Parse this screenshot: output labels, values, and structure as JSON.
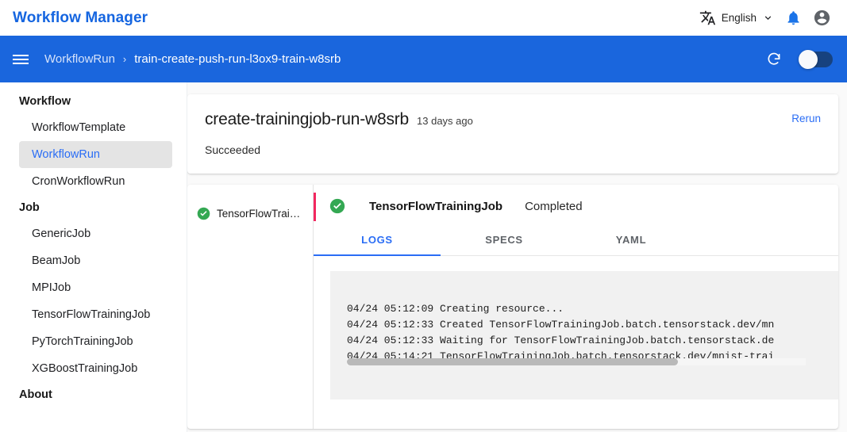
{
  "appbar": {
    "title": "Workflow Manager",
    "translate_icon": "translate-icon",
    "language": "English",
    "chevron_icon": "chevron-down-icon",
    "notifications_icon": "bell-icon",
    "account_icon": "account-circle-icon"
  },
  "breadcrumb": {
    "menu_icon": "hamburger-menu-icon",
    "parent": "WorkflowRun",
    "separator": "›",
    "current": "train-create-push-run-l3ox9-train-w8srb",
    "refresh_icon": "refresh-icon",
    "toggle_state": "on"
  },
  "sidebar": {
    "groups": [
      {
        "header": "Workflow",
        "items": [
          {
            "label": "WorkflowTemplate",
            "active": false
          },
          {
            "label": "WorkflowRun",
            "active": true
          },
          {
            "label": "CronWorkflowRun",
            "active": false
          }
        ]
      },
      {
        "header": "Job",
        "items": [
          {
            "label": "GenericJob",
            "active": false
          },
          {
            "label": "BeamJob",
            "active": false
          },
          {
            "label": "MPIJob",
            "active": false
          },
          {
            "label": "TensorFlowTrainingJob",
            "active": false
          },
          {
            "label": "PyTorchTrainingJob",
            "active": false
          },
          {
            "label": "XGBoostTrainingJob",
            "active": false
          }
        ]
      },
      {
        "header": "About",
        "items": []
      }
    ]
  },
  "summary": {
    "name": "create-trainingjob-run-w8srb",
    "age": "13 days ago",
    "rerun_label": "Rerun",
    "status": "Succeeded"
  },
  "detail": {
    "job_list": [
      {
        "status_icon": "check-circle-icon",
        "label": "TensorFlowTrai…"
      }
    ],
    "status_icon": "check-circle-icon",
    "title": "TensorFlowTrainingJob",
    "state": "Completed",
    "tabs": [
      {
        "label": "LOGS",
        "active": true
      },
      {
        "label": "SPECS",
        "active": false
      },
      {
        "label": "YAML",
        "active": false
      }
    ],
    "log_lines": [
      "04/24 05:12:09 Creating resource...",
      "04/24 05:12:33 Created TensorFlowTrainingJob.batch.tensorstack.dev/mn",
      "04/24 05:12:33 Waiting for TensorFlowTrainingJob.batch.tensorstack.de",
      "04/24 05:14:21 TensorFlowTrainingJob.batch.tensorstack.dev/mnist-trai"
    ],
    "scrollbar": "horizontal-scrollbar"
  },
  "colors": {
    "brand_blue": "#1a66dd",
    "link_blue": "#2a6df5",
    "success_green": "#34a853",
    "accent_pink": "#f2275f"
  }
}
